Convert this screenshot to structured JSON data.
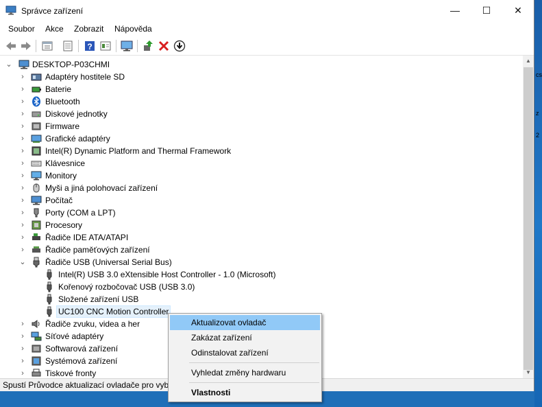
{
  "window": {
    "title": "Správce zařízení",
    "controls": {
      "minimize": "—",
      "maximize": "☐",
      "close": "✕"
    }
  },
  "menu": [
    "Soubor",
    "Akce",
    "Zobrazit",
    "Nápověda"
  ],
  "toolbar_icons": [
    "back-arrow-icon",
    "forward-arrow-icon",
    "tree-view-icon",
    "properties-icon",
    "help-icon",
    "view-icon",
    "monitor-icon",
    "update-driver-icon",
    "uninstall-icon",
    "download-icon"
  ],
  "tree": {
    "root": "DESKTOP-P03CHMI",
    "categories": [
      {
        "label": "Adaptéry hostitele SD",
        "icon": "sd-adapter-icon",
        "expanded": false
      },
      {
        "label": "Baterie",
        "icon": "battery-icon",
        "expanded": false
      },
      {
        "label": "Bluetooth",
        "icon": "bluetooth-icon",
        "expanded": false
      },
      {
        "label": "Diskové jednotky",
        "icon": "disk-drive-icon",
        "expanded": false
      },
      {
        "label": "Firmware",
        "icon": "firmware-icon",
        "expanded": false
      },
      {
        "label": "Grafické adaptéry",
        "icon": "display-adapter-icon",
        "expanded": false
      },
      {
        "label": "Intel(R) Dynamic Platform and Thermal Framework",
        "icon": "chip-icon",
        "expanded": false
      },
      {
        "label": "Klávesnice",
        "icon": "keyboard-icon",
        "expanded": false
      },
      {
        "label": "Monitory",
        "icon": "monitor-icon",
        "expanded": false
      },
      {
        "label": "Myši a jiná polohovací zařízení",
        "icon": "mouse-icon",
        "expanded": false
      },
      {
        "label": "Počítač",
        "icon": "computer-icon",
        "expanded": false
      },
      {
        "label": "Porty (COM a LPT)",
        "icon": "port-icon",
        "expanded": false
      },
      {
        "label": "Procesory",
        "icon": "processor-icon",
        "expanded": false
      },
      {
        "label": "Řadiče IDE ATA/ATAPI",
        "icon": "ide-controller-icon",
        "expanded": false
      },
      {
        "label": "Řadiče paměťových zařízení",
        "icon": "storage-controller-icon",
        "expanded": false
      },
      {
        "label": "Řadiče USB (Universal Serial Bus)",
        "icon": "usb-icon",
        "expanded": true,
        "children": [
          "Intel(R) USB 3.0 eXtensible Host Controller - 1.0 (Microsoft)",
          "Kořenový rozbočovač USB (USB 3.0)",
          "Složené zařízení USB",
          "UC100 CNC Motion Controller"
        ],
        "selected_child": 3
      },
      {
        "label": "Řadiče zvuku, videa a her",
        "icon": "sound-icon",
        "expanded": false
      },
      {
        "label": "Síťové adaptéry",
        "icon": "network-icon",
        "expanded": false
      },
      {
        "label": "Softwarová zařízení",
        "icon": "software-device-icon",
        "expanded": false
      },
      {
        "label": "Systémová zařízení",
        "icon": "system-device-icon",
        "expanded": false
      },
      {
        "label": "Tiskové fronty",
        "icon": "printer-icon",
        "expanded": false
      }
    ]
  },
  "context_menu": {
    "items": [
      {
        "label": "Aktualizovat ovladač",
        "highlighted": true
      },
      {
        "label": "Zakázat zařízení"
      },
      {
        "label": "Odinstalovat zařízení"
      },
      {
        "label": "Vyhledat změny hardwaru"
      },
      {
        "label": "Vlastnosti",
        "bold": true
      }
    ]
  },
  "status": "Spustí Průvodce aktualizací ovladače pro vybr",
  "desktop_fragments": [
    "cs",
    "z",
    "2"
  ],
  "colors": {
    "selection": "#e5f1fb",
    "menu_highlight": "#91c9f7",
    "desktop": "#1f6fb8"
  }
}
